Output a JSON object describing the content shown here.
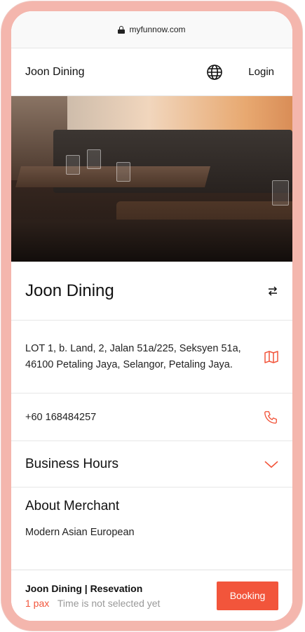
{
  "browser": {
    "url": "myfunnow.com"
  },
  "header": {
    "brand": "Joon Dining",
    "login_label": "Login"
  },
  "merchant": {
    "name": "Joon Dining",
    "address": "LOT 1, b. Land, 2, Jalan 51a/225, Seksyen 51a, 46100 Petaling Jaya, Selangor, Petaling Jaya.",
    "phone": "+60 168484257"
  },
  "sections": {
    "business_hours": "Business Hours",
    "about_title": "About Merchant",
    "about_text": "Modern Asian European"
  },
  "booking_bar": {
    "title": "Joon Dining | Resevation",
    "pax": "1 pax",
    "time_status": "Time is not selected yet",
    "button_label": "Booking"
  },
  "colors": {
    "accent": "#f2553b",
    "frame": "#f4b6ad"
  },
  "icons": [
    "lock-icon",
    "globe-icon",
    "swap-icon",
    "map-icon",
    "phone-icon",
    "chevron-down-icon"
  ]
}
